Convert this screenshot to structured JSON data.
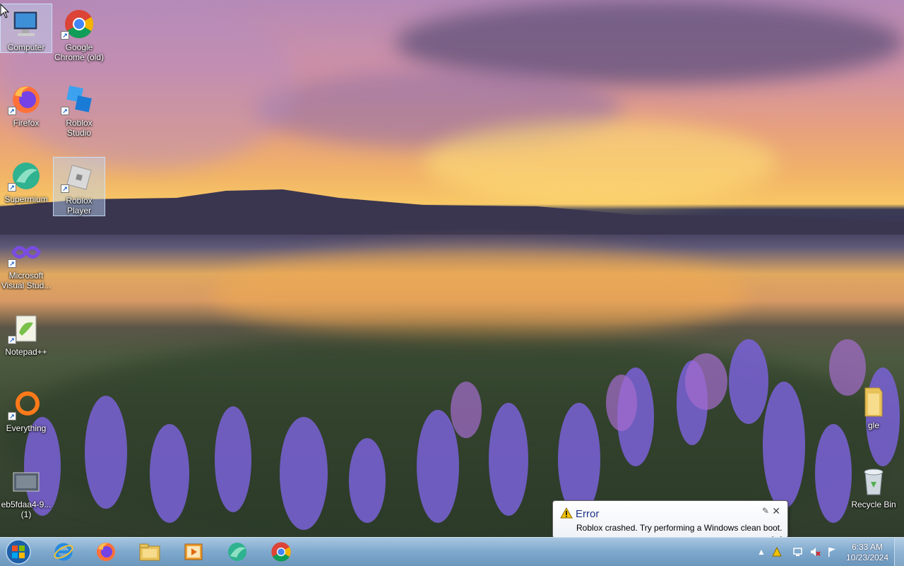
{
  "desktop": {
    "icons": [
      {
        "label": "Computer",
        "icon": "computer-icon"
      },
      {
        "label": "Google Chrome (old)",
        "icon": "chrome-icon"
      },
      {
        "label": "Firefox",
        "icon": "firefox-icon"
      },
      {
        "label": "Roblox Studio",
        "icon": "roblox-studio-icon"
      },
      {
        "label": "Supermium",
        "icon": "supermium-icon"
      },
      {
        "label": "Roblox Player",
        "icon": "roblox-player-icon"
      },
      {
        "label": "Microsoft Visual Stud...",
        "icon": "visual-studio-icon"
      },
      {
        "label": "Notepad++",
        "icon": "notepadpp-icon"
      },
      {
        "label": "Everything",
        "icon": "everything-icon"
      },
      {
        "label": "eb5fdaa4-9... (1)",
        "icon": "video-file-icon"
      },
      {
        "label": "gle",
        "icon": "folder-icon"
      },
      {
        "label": "Recycle Bin",
        "icon": "recycle-bin-icon"
      }
    ]
  },
  "taskbar": {
    "pinned": [
      {
        "name": "internet-explorer",
        "icon": "ie-icon"
      },
      {
        "name": "firefox",
        "icon": "firefox-icon"
      },
      {
        "name": "file-explorer",
        "icon": "folder-icon"
      },
      {
        "name": "media-player",
        "icon": "media-player-icon"
      },
      {
        "name": "supermium",
        "icon": "supermium-icon"
      },
      {
        "name": "chrome",
        "icon": "chrome-icon"
      }
    ],
    "clock": {
      "time": "6:33 AM",
      "date": "10/23/2024"
    }
  },
  "notification": {
    "title": "Error",
    "message": "Roblox crashed. Try performing a Windows clean boot."
  },
  "colors": {
    "taskbar": "#7ea8cd",
    "balloon_title": "#1e3287",
    "warning": "#f2c200"
  }
}
